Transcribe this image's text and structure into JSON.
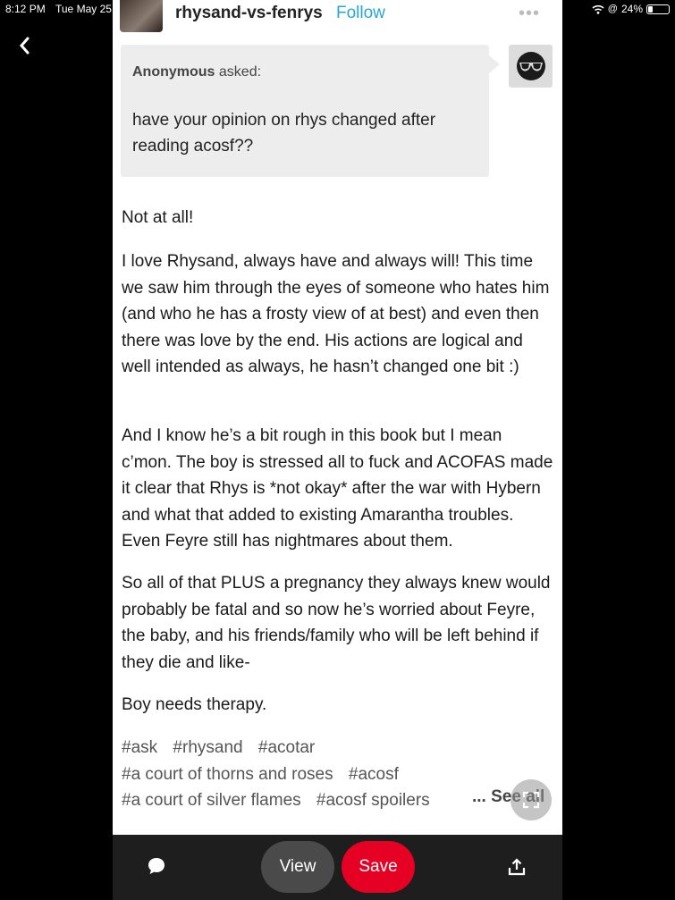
{
  "status_bar": {
    "time": "8:12 PM",
    "date": "Tue May 25",
    "battery": "24%",
    "battery_level": 0.24
  },
  "post": {
    "blog_name": "rhysand-vs-fenrys",
    "follow_label": "Follow",
    "ask": {
      "asker": "Anonymous",
      "asked_label": " asked:",
      "question": "have your opinion on rhys changed after reading acosf??"
    },
    "answer": [
      "Not at all!",
      "I love Rhysand, always have and always will! This time we saw him through the eyes of someone who hates him (and who he has a frosty view of at best) and even then there was love by the end.  His actions are logical and well intended as always, he hasn’t changed one bit :)",
      "And I know he’s a bit rough in this book but I mean c’mon. The boy is stressed all to fuck and ACOFAS made it clear that Rhys is *not okay* after the war with Hybern and what that added to existing Amarantha troubles. Even Feyre still has nightmares about them.",
      "So all of that PLUS a pregnancy they always knew would probably be fatal and so now he’s worried about Feyre, the baby, and his friends/family who will be left behind if they die and like-",
      "Boy needs therapy."
    ],
    "tags": [
      "#ask",
      "#rhysand",
      "#acotar",
      "#a court of thorns and roses",
      "#acosf",
      "#a court of silver flames",
      "#acosf spoilers"
    ],
    "see_all_label": "... See all"
  },
  "bottom_bar": {
    "view_label": "View",
    "save_label": "Save"
  },
  "colors": {
    "follow": "#2aa5d8",
    "save": "#e60023",
    "view": "#4a4a4a"
  }
}
